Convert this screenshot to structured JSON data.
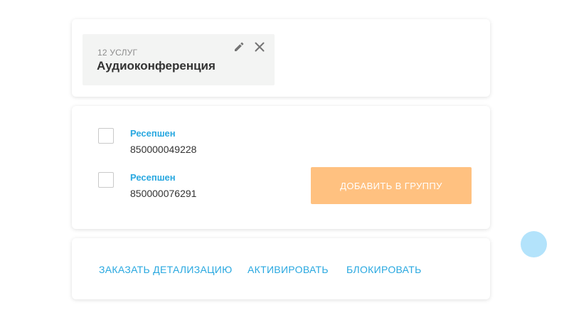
{
  "group": {
    "count_label": "12 УСЛУГ",
    "name": "Аудиоконференция",
    "icons": {
      "edit": "pencil-icon",
      "close": "close-icon"
    }
  },
  "members": [
    {
      "name": "Ресепшен",
      "number": "850000049228",
      "checked": false
    },
    {
      "name": "Ресепшен",
      "number": "850000076291",
      "checked": false
    }
  ],
  "add_button_label": "ДОБАВИТЬ В ГРУППУ",
  "actions": {
    "detail": "ЗАКАЗАТЬ ДЕТАЛИЗАЦИЮ",
    "activate": "АКТИВИРОВАТЬ",
    "block": "БЛОКИРОВАТЬ"
  },
  "colors": {
    "link": "#29a8e0",
    "button_disabled": "#ffc180",
    "chip_bg": "#f3f4f3",
    "floating_dot": "#b3e3fb"
  }
}
